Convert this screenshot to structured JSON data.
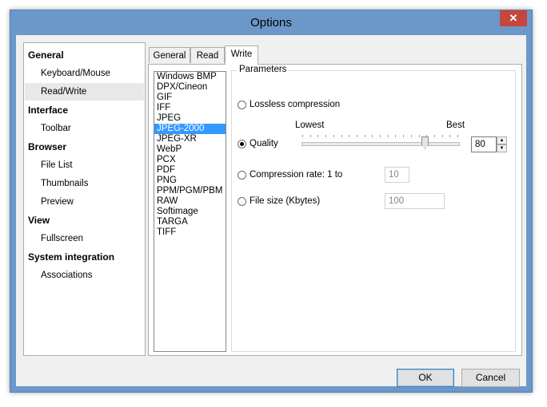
{
  "window": {
    "title": "Options",
    "close_label": "✕"
  },
  "nav": {
    "general": "General",
    "keyboard_mouse": "Keyboard/Mouse",
    "read_write": "Read/Write",
    "interface": "Interface",
    "toolbar": "Toolbar",
    "browser": "Browser",
    "file_list": "File List",
    "thumbnails": "Thumbnails",
    "preview": "Preview",
    "view": "View",
    "fullscreen": "Fullscreen",
    "system_integration": "System integration",
    "associations": "Associations"
  },
  "tabs": {
    "general": "General",
    "read": "Read",
    "write": "Write"
  },
  "formats": [
    "Windows BMP",
    "DPX/Cineon",
    "GIF",
    "IFF",
    "JPEG",
    "JPEG-2000",
    "JPEG-XR",
    "WebP",
    "PCX",
    "PDF",
    "PNG",
    "PPM/PGM/PBM",
    "RAW",
    "Softimage",
    "TARGA",
    "TIFF"
  ],
  "selected_format": "JPEG-2000",
  "parameters": {
    "label": "Parameters",
    "lossless": "Lossless compression",
    "quality": "Quality",
    "lowest": "Lowest",
    "best": "Best",
    "quality_value": "80",
    "compression_rate": "Compression rate: 1 to",
    "compression_value": "10",
    "file_size": "File size (Kbytes)",
    "file_size_value": "100"
  },
  "buttons": {
    "ok": "OK",
    "cancel": "Cancel"
  }
}
